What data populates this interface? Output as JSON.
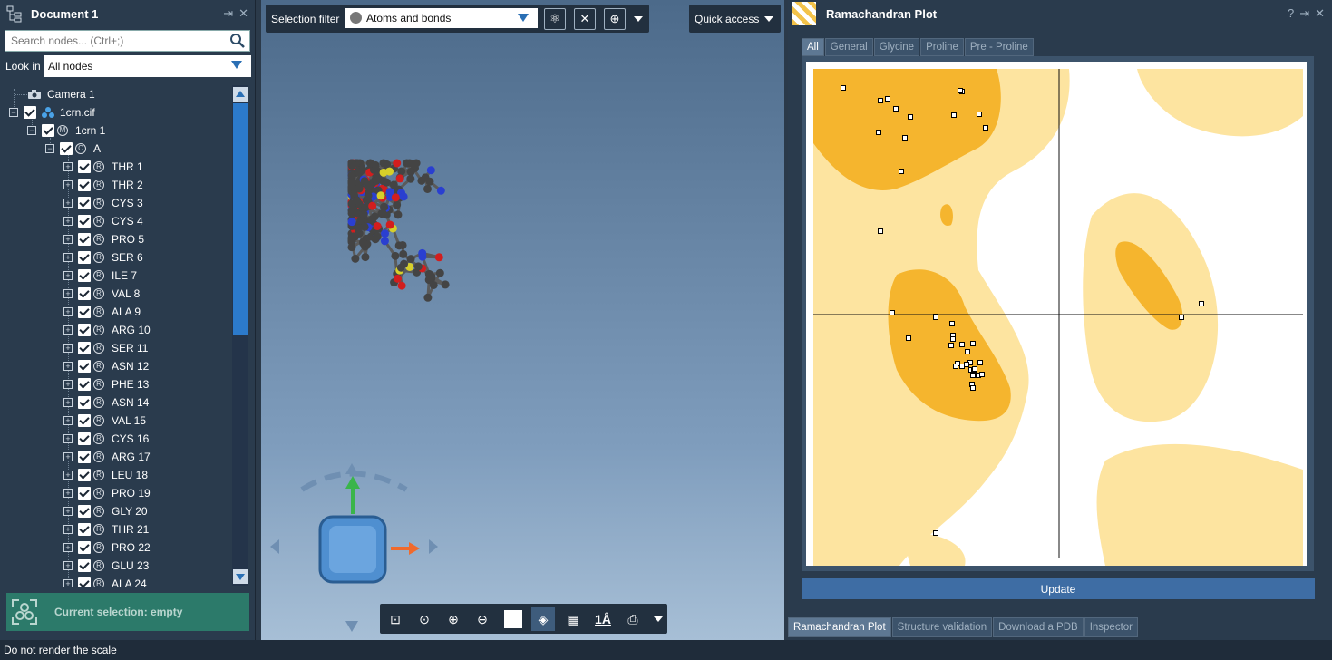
{
  "left_panel": {
    "title": "Document 1",
    "search_placeholder": "Search nodes... (Ctrl+;)",
    "lookin_label": "Look in",
    "lookin_value": "All nodes",
    "tree": {
      "camera": "Camera 1",
      "file": "1crn.cif",
      "model": "1crn 1",
      "chain": "A",
      "residues": [
        "THR 1",
        "THR 2",
        "CYS 3",
        "CYS 4",
        "PRO 5",
        "SER 6",
        "ILE 7",
        "VAL 8",
        "ALA 9",
        "ARG 10",
        "SER 11",
        "ASN 12",
        "PHE 13",
        "ASN 14",
        "VAL 15",
        "CYS 16",
        "ARG 17",
        "LEU 18",
        "PRO 19",
        "GLY 20",
        "THR 21",
        "PRO 22",
        "GLU 23",
        "ALA 24"
      ]
    },
    "selection_status": "Current selection: empty"
  },
  "viewport": {
    "selection_filter_label": "Selection filter",
    "selection_filter_value": "Atoms and bonds",
    "quick_access": "Quick access",
    "bottom_tools": [
      "zoom-fit",
      "zoom-selection",
      "zoom-in",
      "zoom-out",
      "background",
      "perspective",
      "grid",
      "1Å",
      "screenshot"
    ]
  },
  "ramachandran": {
    "title": "Ramachandran Plot",
    "tabs": [
      "All",
      "General",
      "Glycine",
      "Proline",
      "Pre - Proline"
    ],
    "active_tab": "All",
    "update_label": "Update",
    "bottom_tabs": [
      "Ramachandran Plot",
      "Structure validation",
      "Download a PDB",
      "Inspector"
    ],
    "active_bottom_tab": "Ramachandran Plot"
  },
  "status_bar": "Do not render the scale",
  "colors": {
    "accent": "#2c7acb",
    "favored": "#f5b52e",
    "allowed": "#fde4a0"
  }
}
